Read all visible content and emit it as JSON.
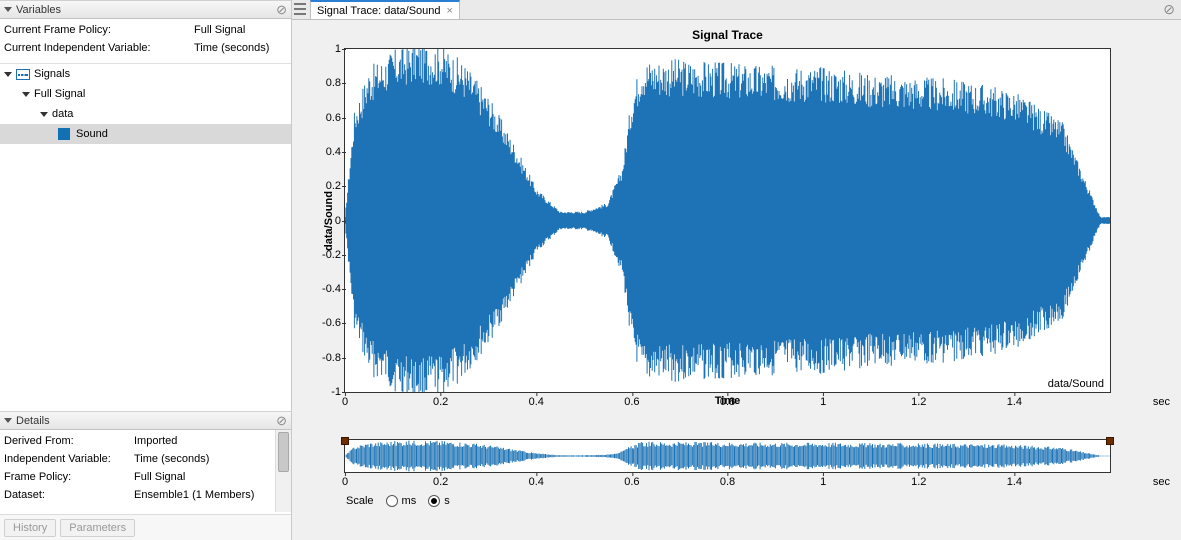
{
  "sidebar": {
    "variables": {
      "header": "Variables",
      "rows": [
        {
          "k": "Current Frame Policy:",
          "v": "Full Signal"
        },
        {
          "k": "Current Independent Variable:",
          "v": "Time (seconds)"
        }
      ],
      "tree": {
        "root": "Signals",
        "n1": "Full Signal",
        "n2": "data",
        "leaf": "Sound"
      }
    },
    "details": {
      "header": "Details",
      "rows": [
        {
          "k": "Derived From:",
          "v": "Imported"
        },
        {
          "k": "Independent Variable:",
          "v": "Time (seconds)"
        },
        {
          "k": "Frame Policy:",
          "v": "Full Signal"
        },
        {
          "k": "Dataset:",
          "v": "Ensemble1 (1 Members)"
        }
      ],
      "btn_history": "History",
      "btn_params": "Parameters"
    }
  },
  "main": {
    "tab_label": "Signal Trace: data/Sound",
    "plot_title": "Signal Trace",
    "ylabel": "data/Sound",
    "xlabel": "Time",
    "x_unit": "sec",
    "series_label": "data/Sound",
    "scale_label": "Scale",
    "scale_ms": "ms",
    "scale_s": "s"
  },
  "chart_data": {
    "type": "line",
    "title": "Signal Trace",
    "xlabel": "Time",
    "ylabel": "data/Sound",
    "xlim": [
      0,
      1.6
    ],
    "ylim": [
      -1,
      1
    ],
    "x_unit": "sec",
    "xticks": [
      0,
      0.2,
      0.4,
      0.6,
      0.8,
      1,
      1.2,
      1.4
    ],
    "yticks": [
      -1,
      -0.8,
      -0.6,
      -0.4,
      -0.2,
      0,
      0.2,
      0.4,
      0.6,
      0.8,
      1
    ],
    "series": [
      {
        "name": "data/Sound"
      }
    ],
    "envelope": [
      {
        "t": 0.0,
        "amp": 0.02
      },
      {
        "t": 0.02,
        "amp": 0.62
      },
      {
        "t": 0.05,
        "amp": 0.85
      },
      {
        "t": 0.1,
        "amp": 0.95
      },
      {
        "t": 0.15,
        "amp": 1.0
      },
      {
        "t": 0.2,
        "amp": 0.98
      },
      {
        "t": 0.25,
        "amp": 0.88
      },
      {
        "t": 0.3,
        "amp": 0.7
      },
      {
        "t": 0.35,
        "amp": 0.45
      },
      {
        "t": 0.4,
        "amp": 0.18
      },
      {
        "t": 0.45,
        "amp": 0.05
      },
      {
        "t": 0.5,
        "amp": 0.05
      },
      {
        "t": 0.55,
        "amp": 0.1
      },
      {
        "t": 0.58,
        "amp": 0.3
      },
      {
        "t": 0.6,
        "amp": 0.7
      },
      {
        "t": 0.62,
        "amp": 0.9
      },
      {
        "t": 0.7,
        "amp": 0.9
      },
      {
        "t": 0.8,
        "amp": 0.88
      },
      {
        "t": 0.9,
        "amp": 0.86
      },
      {
        "t": 1.0,
        "amp": 0.86
      },
      {
        "t": 1.1,
        "amp": 0.82
      },
      {
        "t": 1.2,
        "amp": 0.8
      },
      {
        "t": 1.3,
        "amp": 0.78
      },
      {
        "t": 1.4,
        "amp": 0.72
      },
      {
        "t": 1.5,
        "amp": 0.55
      },
      {
        "t": 1.56,
        "amp": 0.15
      },
      {
        "t": 1.58,
        "amp": 0.02
      }
    ],
    "overview_xticks": [
      0,
      0.2,
      0.4,
      0.6,
      0.8,
      1,
      1.2,
      1.4
    ]
  }
}
